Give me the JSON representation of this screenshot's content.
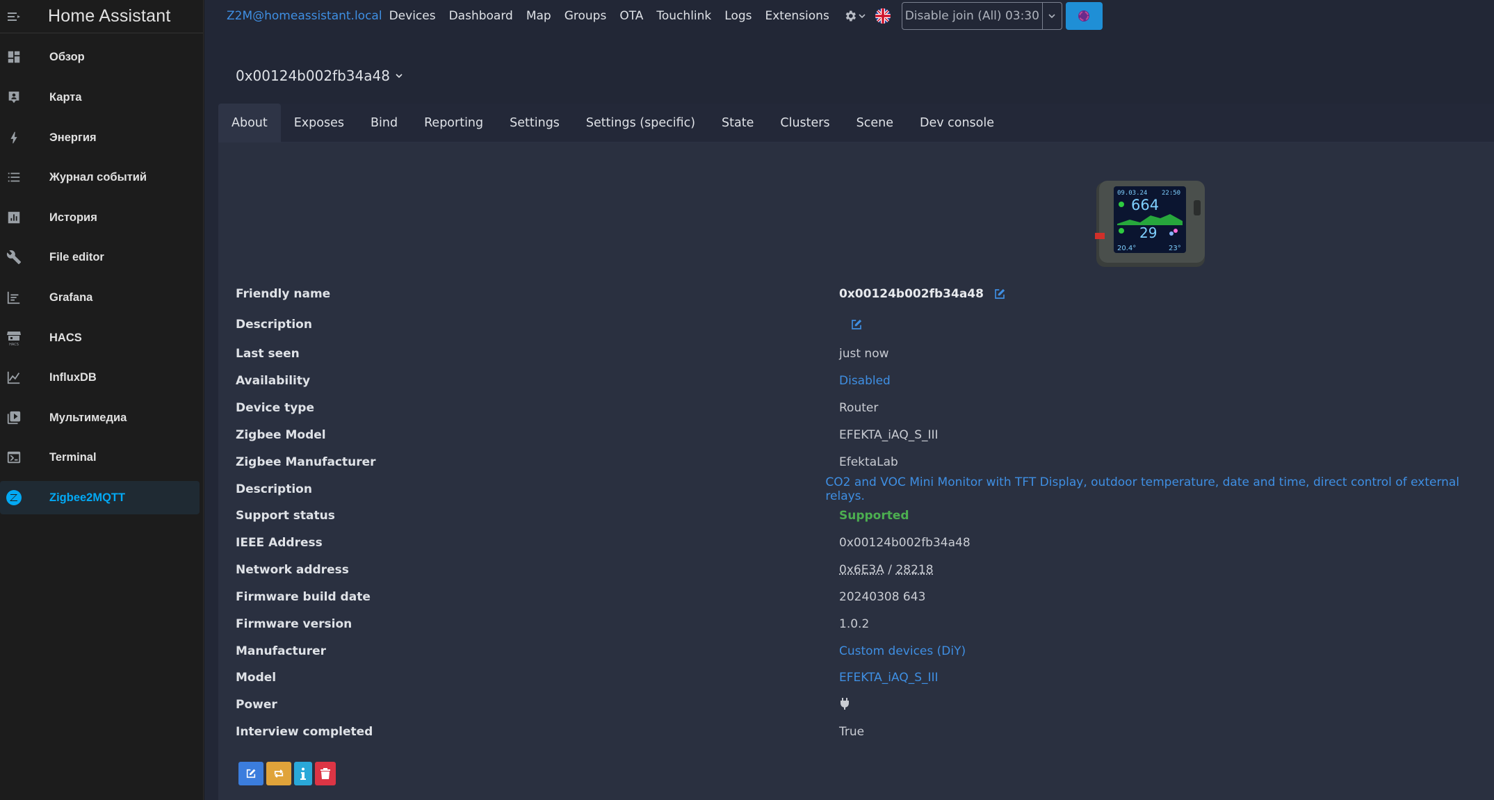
{
  "app": {
    "title": "Home Assistant"
  },
  "sidebar": {
    "items": [
      {
        "label": "Обзор",
        "icon": "dashboard-icon"
      },
      {
        "label": "Карта",
        "icon": "map-icon"
      },
      {
        "label": "Энергия",
        "icon": "lightning-icon"
      },
      {
        "label": "Журнал событий",
        "icon": "logbook-icon"
      },
      {
        "label": "История",
        "icon": "history-chart-icon"
      },
      {
        "label": "File editor",
        "icon": "wrench-icon"
      },
      {
        "label": "Grafana",
        "icon": "grafana-icon"
      },
      {
        "label": "HACS",
        "icon": "hacs-icon"
      },
      {
        "label": "InfluxDB",
        "icon": "influx-chart-icon"
      },
      {
        "label": "Мультимедиа",
        "icon": "media-icon"
      },
      {
        "label": "Terminal",
        "icon": "terminal-icon"
      },
      {
        "label": "Zigbee2MQTT",
        "icon": "zigbee-icon",
        "active": true
      }
    ]
  },
  "topbar": {
    "instance": "Z2M@homeassistant.local",
    "nav": [
      "Devices",
      "Dashboard",
      "Map",
      "Groups",
      "OTA",
      "Touchlink",
      "Logs",
      "Extensions"
    ],
    "join_button": "Disable join (All) 03:30",
    "accent": "#1f8fd6"
  },
  "device": {
    "title": "0x00124b002fb34a48",
    "tabs": [
      "About",
      "Exposes",
      "Bind",
      "Reporting",
      "Settings",
      "Settings (specific)",
      "State",
      "Clusters",
      "Scene",
      "Dev console"
    ],
    "active_tab": "About",
    "screen": {
      "date": "09.03.24",
      "time": "22:50",
      "co2": "664",
      "voc": "29",
      "temp_out": "20.4°",
      "temp_in": "23°"
    },
    "fields": {
      "friendly_name_label": "Friendly name",
      "friendly_name": "0x00124b002fb34a48",
      "description_label": "Description",
      "last_seen_label": "Last seen",
      "last_seen": "just now",
      "availability_label": "Availability",
      "availability": "Disabled",
      "device_type_label": "Device type",
      "device_type": "Router",
      "zigbee_model_label": "Zigbee Model",
      "zigbee_model": "EFEKTA_iAQ_S_III",
      "zigbee_manufacturer_label": "Zigbee Manufacturer",
      "zigbee_manufacturer": "EfektaLab",
      "description2_label": "Description",
      "description2": "CO2 and VOC Mini Monitor with TFT Display, outdoor temperature, date and time, direct control of external relays.",
      "support_status_label": "Support status",
      "support_status": "Supported",
      "ieee_label": "IEEE Address",
      "ieee": "0x00124b002fb34a48",
      "network_label": "Network address",
      "network_hex": "0x6E3A",
      "network_sep": " / ",
      "network_dec": "28218",
      "fw_date_label": "Firmware build date",
      "fw_date": "20240308 643",
      "fw_version_label": "Firmware version",
      "fw_version": "1.0.2",
      "manufacturer_label": "Manufacturer",
      "manufacturer": "Custom devices (DiY)",
      "model_label": "Model",
      "model": "EFEKTA_iAQ_S_III",
      "power_label": "Power",
      "interview_label": "Interview completed",
      "interview": "True"
    },
    "action_colors": {
      "edit": "#3b7ddd",
      "reconfigure": "#e0a33a",
      "info": "#2aa8d8",
      "delete": "#dc3545"
    }
  }
}
